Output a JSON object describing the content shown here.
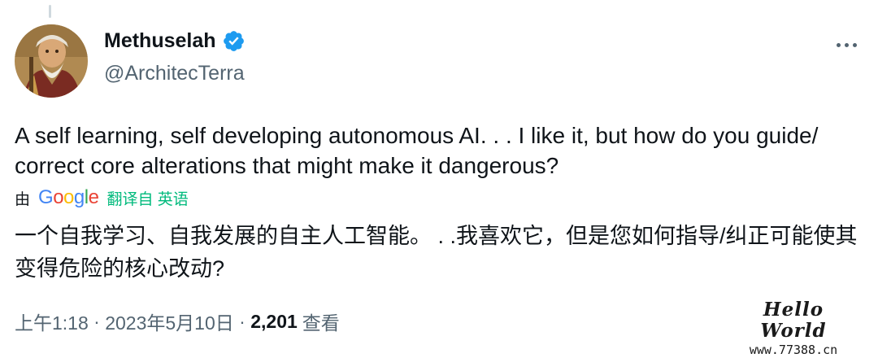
{
  "author": {
    "display_name": "Methuselah",
    "handle": "@ArchitecTerra",
    "verified_icon": "verified-badge-icon",
    "avatar_icon": "avatar-portrait"
  },
  "more_icon": "more-options-icon",
  "tweet": {
    "text": "A self learning, self developing autonomous AI. . . I like it, but how do you guide/ correct core alterations that might make it dangerous?"
  },
  "translation": {
    "by_label": "由",
    "provider": "Google",
    "from_label": "翻译自 英语",
    "text": "一个自我学习、自我发展的自主人工智能。 . .我喜欢它，但是您如何指导/纠正可能使其变得危险的核心改动?"
  },
  "meta": {
    "time": "上午1:18",
    "separator": " · ",
    "date": "2023年5月10日",
    "views_count": "2,201",
    "views_label": "查看"
  },
  "watermark": {
    "title": "Hello World",
    "url": "www.77388.cn"
  },
  "colors": {
    "brand_blue": "#1d9bf0",
    "text_primary": "#0f1419",
    "text_secondary": "#536471",
    "translate_green": "#00ba7c"
  }
}
